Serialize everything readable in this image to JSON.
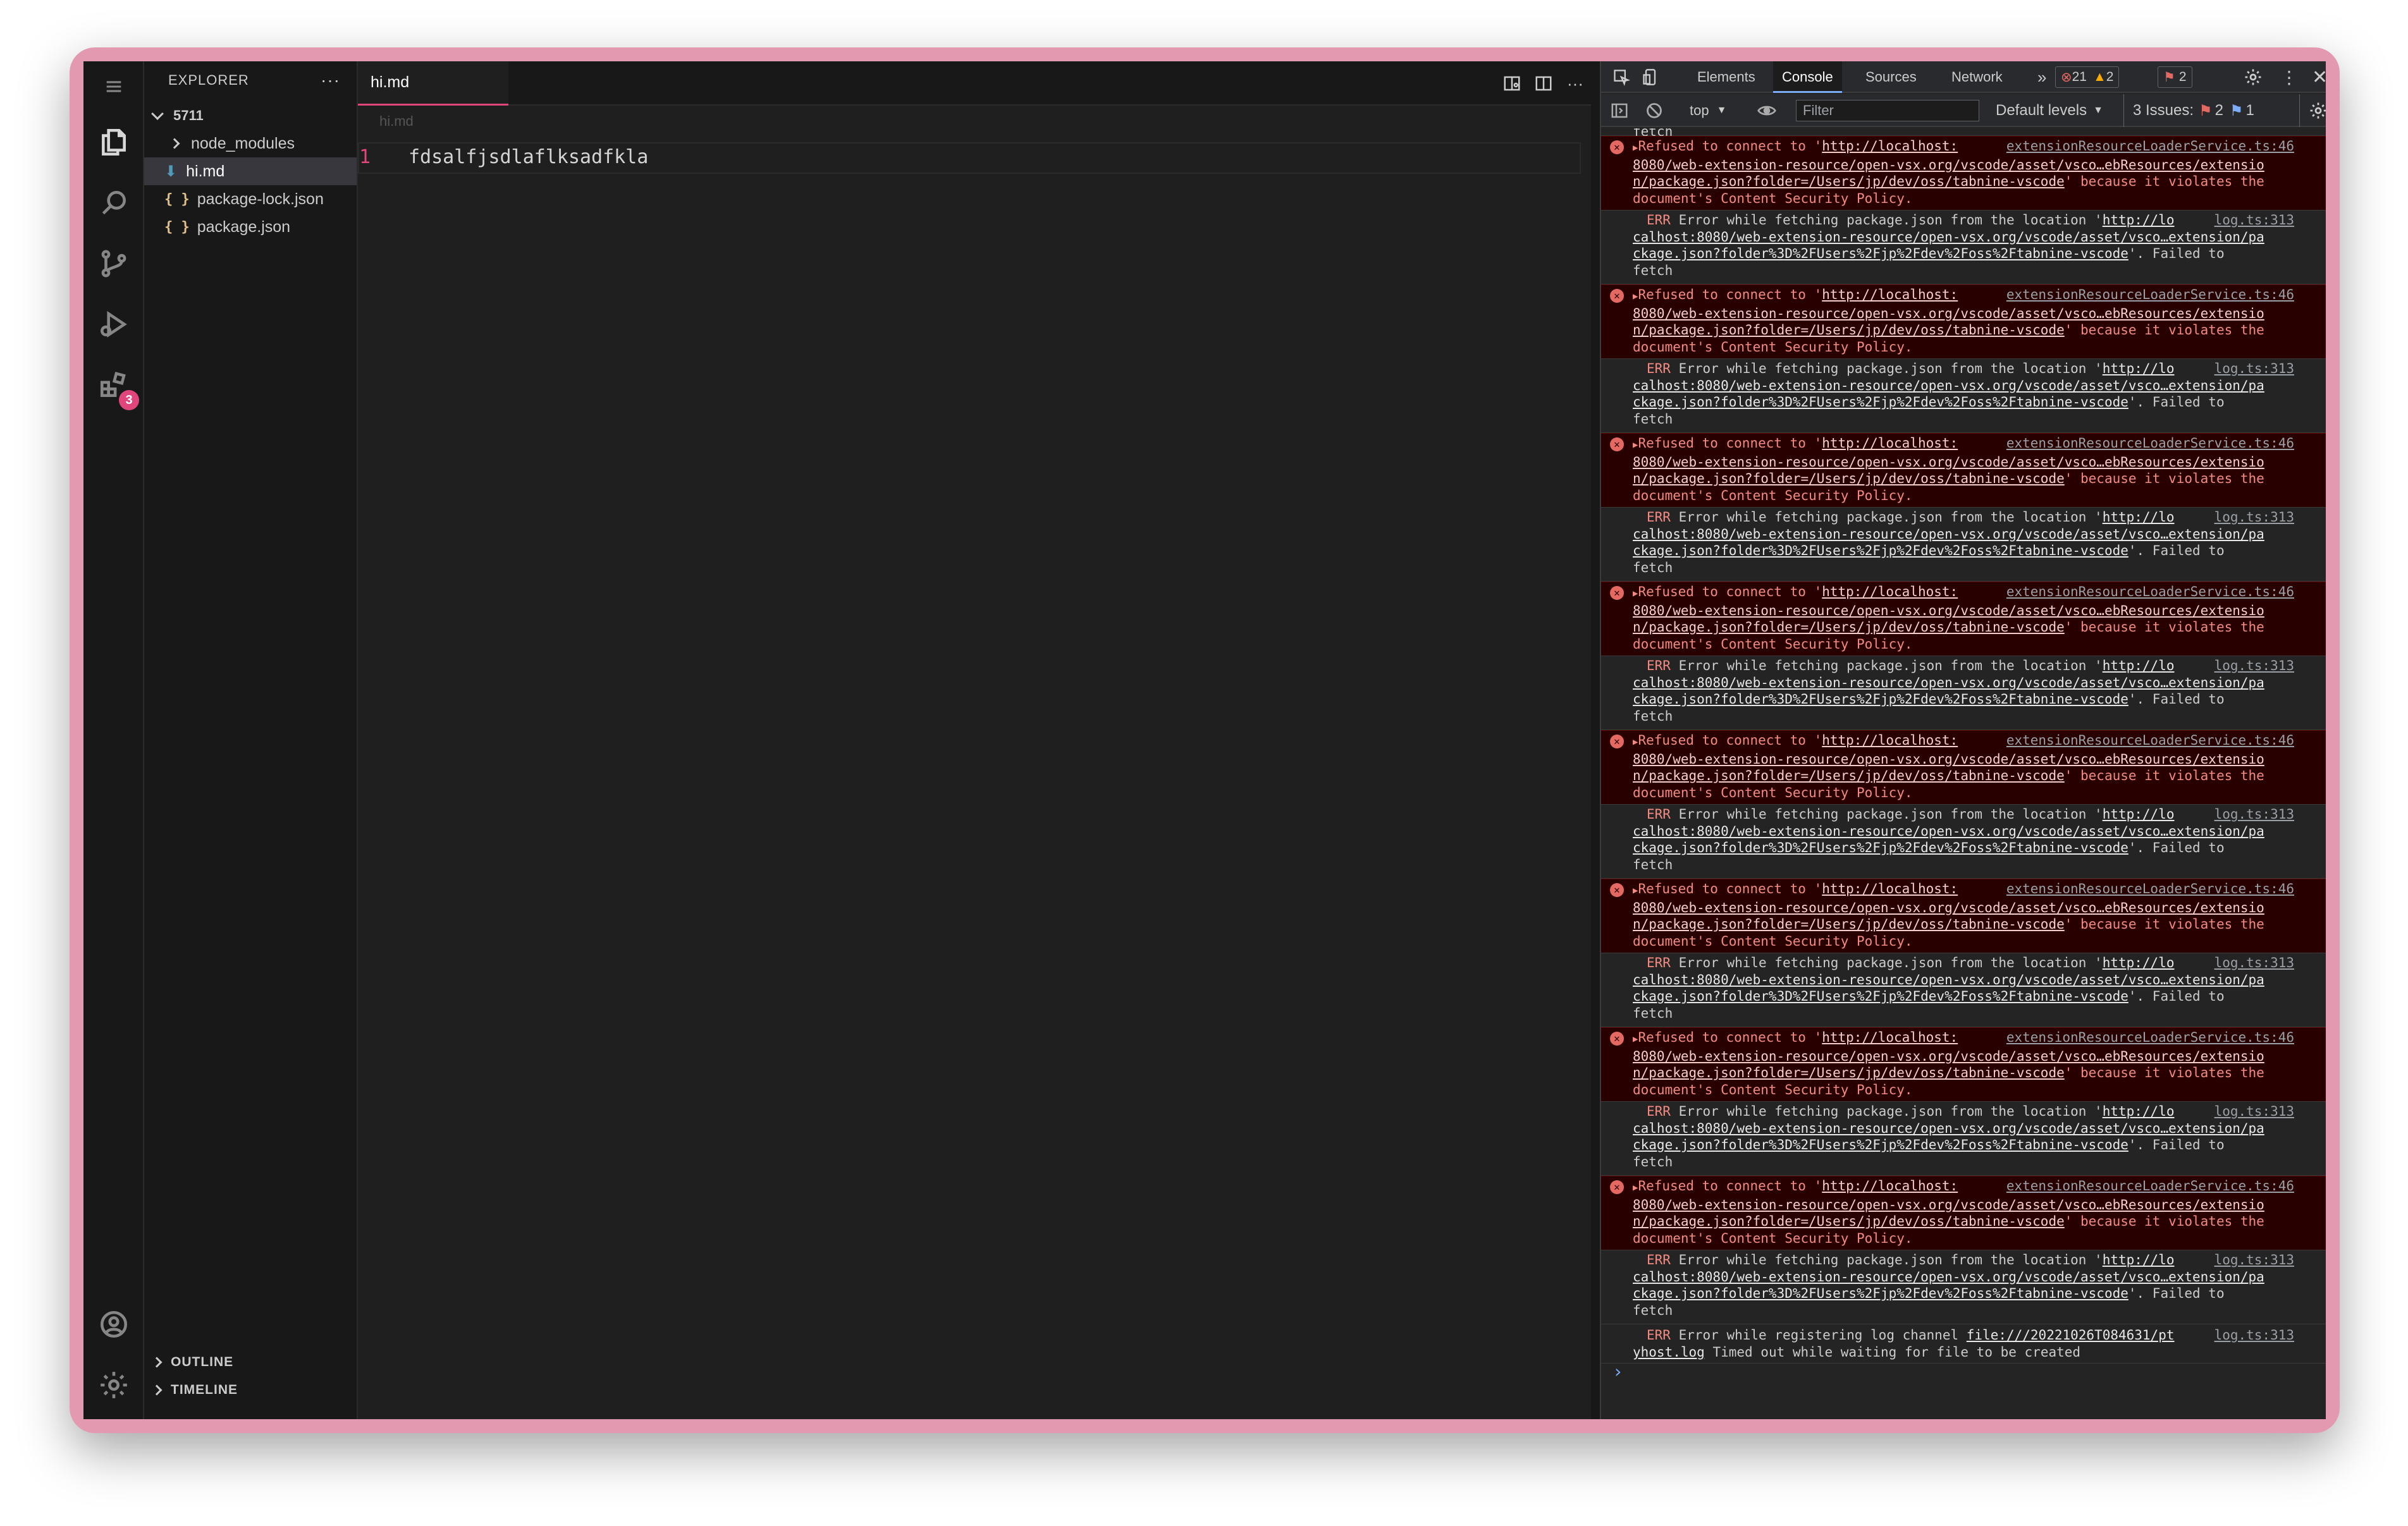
{
  "activity": {
    "badge": "3"
  },
  "explorer": {
    "header": "EXPLORER",
    "more": "···",
    "root": "5711",
    "items": [
      "node_modules",
      "hi.md",
      "package-lock.json",
      "package.json"
    ],
    "json_icon": "{ }",
    "outline": "OUTLINE",
    "timeline": "TIMELINE"
  },
  "editor": {
    "tab": "hi.md",
    "breadcrumb": "hi.md",
    "line_number": "1",
    "line_text": "fdsalfjsdlaflksadfkla",
    "more": "···"
  },
  "devtools": {
    "tabs": [
      "Elements",
      "Console",
      "Sources",
      "Network"
    ],
    "more_tabs": "»",
    "counts": {
      "errors": "21",
      "warnings": "2",
      "issues_flag": "2"
    },
    "toolbar": {
      "context": "top",
      "filter_placeholder": "Filter",
      "levels": "Default levels",
      "issues_label": "3 Issues:",
      "issues_err": "2",
      "issues_info": "1"
    },
    "top_fragment": "fetch",
    "refused": {
      "prefix": "Refused to connect to '",
      "link1": "http://localhost:",
      "source": "extensionResourceLoaderService.ts:46",
      "link2": "8080/web-extension-resource/open-vsx.org/vscode/asset/vsco…ebResources/extensio",
      "link3": "n/package.json?folder=/Users/jp/dev/oss/tabnine-vscode",
      "suffix": "' because it violates the",
      "line4": "document's Content Security Policy."
    },
    "fetch_err": {
      "tag": "ERR",
      "text": "Error while fetching package.json from the location '",
      "link1": "http://lo",
      "source": "log.ts:313",
      "link2": "calhost:8080/web-extension-resource/open-vsx.org/vscode/asset/vsco…extension/pa",
      "link3": "ckage.json?folder%3D%2FUsers%2Fjp%2Fdev%2Foss%2Ftabnine-vscode",
      "suffix": "'. Failed to",
      "line4": "fetch"
    },
    "last_err": {
      "tag": "ERR",
      "text": "Error while registering log channel",
      "link1": "file:///20221026T084631/pt",
      "source": "log.ts:313",
      "link2": "yhost.log",
      "suffix": "Timed out while waiting for file to be created"
    },
    "prompt": "›"
  },
  "colors": {
    "accent": "#e0457b",
    "frame": "#e39ab0"
  }
}
